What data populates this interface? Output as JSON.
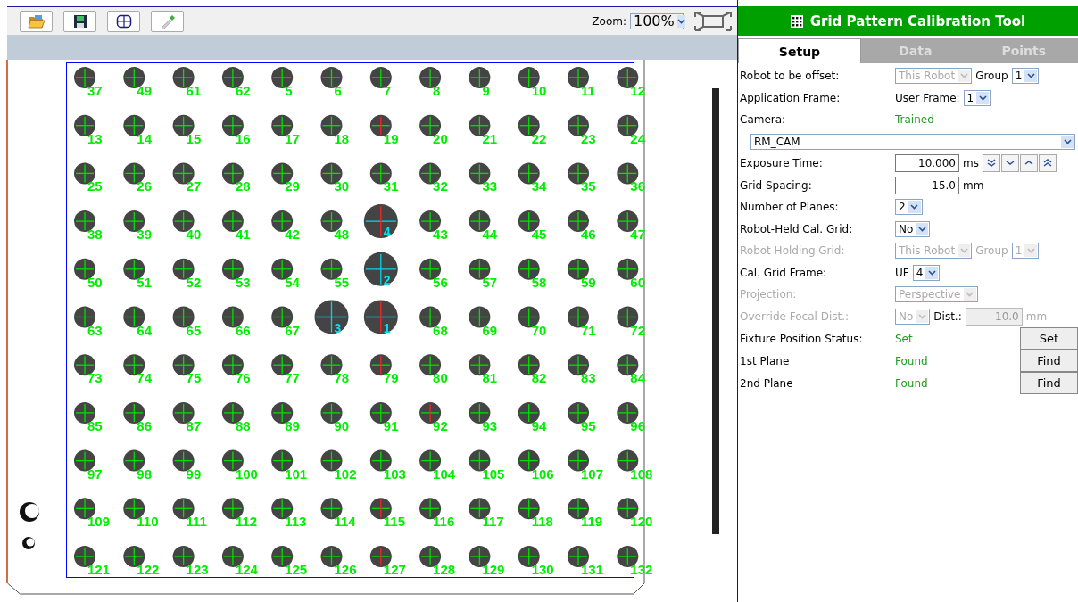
{
  "toolbar": {
    "zoom_label": "Zoom:",
    "zoom_value": "100%"
  },
  "grid": {
    "rows": [
      [
        {
          "label": "37",
          "large": false,
          "flagged": false
        },
        {
          "label": "49",
          "large": false,
          "flagged": false
        },
        {
          "label": "61",
          "large": false,
          "flagged": false
        },
        {
          "label": "62",
          "large": false,
          "flagged": false
        },
        {
          "label": "5",
          "large": false,
          "flagged": false
        },
        {
          "label": "6",
          "large": false,
          "flagged": false
        },
        {
          "label": "7",
          "large": false,
          "flagged": false
        },
        {
          "label": "8",
          "large": false,
          "flagged": false
        },
        {
          "label": "9",
          "large": false,
          "flagged": false
        },
        {
          "label": "10",
          "large": false,
          "flagged": false
        },
        {
          "label": "11",
          "large": false,
          "flagged": false
        },
        {
          "label": "12",
          "large": false,
          "flagged": false
        }
      ],
      [
        {
          "label": "13",
          "large": false,
          "flagged": false
        },
        {
          "label": "14",
          "large": false,
          "flagged": false
        },
        {
          "label": "15",
          "large": false,
          "flagged": false
        },
        {
          "label": "16",
          "large": false,
          "flagged": false
        },
        {
          "label": "17",
          "large": false,
          "flagged": false
        },
        {
          "label": "18",
          "large": false,
          "flagged": false
        },
        {
          "label": "19",
          "large": false,
          "flagged": true
        },
        {
          "label": "20",
          "large": false,
          "flagged": false
        },
        {
          "label": "21",
          "large": false,
          "flagged": false
        },
        {
          "label": "22",
          "large": false,
          "flagged": false
        },
        {
          "label": "23",
          "large": false,
          "flagged": false
        },
        {
          "label": "24",
          "large": false,
          "flagged": false
        }
      ],
      [
        {
          "label": "25",
          "large": false,
          "flagged": false
        },
        {
          "label": "26",
          "large": false,
          "flagged": false
        },
        {
          "label": "27",
          "large": false,
          "flagged": false
        },
        {
          "label": "28",
          "large": false,
          "flagged": false
        },
        {
          "label": "29",
          "large": false,
          "flagged": false
        },
        {
          "label": "30",
          "large": false,
          "flagged": false
        },
        {
          "label": "31",
          "large": false,
          "flagged": false
        },
        {
          "label": "32",
          "large": false,
          "flagged": false
        },
        {
          "label": "33",
          "large": false,
          "flagged": false
        },
        {
          "label": "34",
          "large": false,
          "flagged": false
        },
        {
          "label": "35",
          "large": false,
          "flagged": false
        },
        {
          "label": "36",
          "large": false,
          "flagged": false
        }
      ],
      [
        {
          "label": "38",
          "large": false,
          "flagged": false
        },
        {
          "label": "39",
          "large": false,
          "flagged": false
        },
        {
          "label": "40",
          "large": false,
          "flagged": false
        },
        {
          "label": "41",
          "large": false,
          "flagged": false
        },
        {
          "label": "42",
          "large": false,
          "flagged": false
        },
        {
          "label": "48",
          "large": false,
          "flagged": false
        },
        {
          "label": "4",
          "large": true,
          "flagged": true
        },
        {
          "label": "43",
          "large": false,
          "flagged": false
        },
        {
          "label": "44",
          "large": false,
          "flagged": false
        },
        {
          "label": "45",
          "large": false,
          "flagged": false
        },
        {
          "label": "46",
          "large": false,
          "flagged": false
        },
        {
          "label": "47",
          "large": false,
          "flagged": false
        }
      ],
      [
        {
          "label": "50",
          "large": false,
          "flagged": false
        },
        {
          "label": "51",
          "large": false,
          "flagged": false
        },
        {
          "label": "52",
          "large": false,
          "flagged": false
        },
        {
          "label": "53",
          "large": false,
          "flagged": false
        },
        {
          "label": "54",
          "large": false,
          "flagged": false
        },
        {
          "label": "55",
          "large": false,
          "flagged": false
        },
        {
          "label": "2",
          "large": true,
          "flagged": false
        },
        {
          "label": "56",
          "large": false,
          "flagged": false
        },
        {
          "label": "57",
          "large": false,
          "flagged": false
        },
        {
          "label": "58",
          "large": false,
          "flagged": false
        },
        {
          "label": "59",
          "large": false,
          "flagged": false
        },
        {
          "label": "60",
          "large": false,
          "flagged": false
        }
      ],
      [
        {
          "label": "63",
          "large": false,
          "flagged": false
        },
        {
          "label": "64",
          "large": false,
          "flagged": false
        },
        {
          "label": "65",
          "large": false,
          "flagged": false
        },
        {
          "label": "66",
          "large": false,
          "flagged": false
        },
        {
          "label": "67",
          "large": false,
          "flagged": false
        },
        {
          "label": "3",
          "large": true,
          "flagged": false
        },
        {
          "label": "1",
          "large": true,
          "flagged": true
        },
        {
          "label": "68",
          "large": false,
          "flagged": false
        },
        {
          "label": "69",
          "large": false,
          "flagged": false
        },
        {
          "label": "70",
          "large": false,
          "flagged": false
        },
        {
          "label": "71",
          "large": false,
          "flagged": false
        },
        {
          "label": "72",
          "large": false,
          "flagged": false
        }
      ],
      [
        {
          "label": "73",
          "large": false,
          "flagged": false
        },
        {
          "label": "74",
          "large": false,
          "flagged": false
        },
        {
          "label": "75",
          "large": false,
          "flagged": false
        },
        {
          "label": "76",
          "large": false,
          "flagged": false
        },
        {
          "label": "77",
          "large": false,
          "flagged": false
        },
        {
          "label": "78",
          "large": false,
          "flagged": false
        },
        {
          "label": "79",
          "large": false,
          "flagged": true
        },
        {
          "label": "80",
          "large": false,
          "flagged": false
        },
        {
          "label": "81",
          "large": false,
          "flagged": false
        },
        {
          "label": "82",
          "large": false,
          "flagged": false
        },
        {
          "label": "83",
          "large": false,
          "flagged": false
        },
        {
          "label": "84",
          "large": false,
          "flagged": false
        }
      ],
      [
        {
          "label": "85",
          "large": false,
          "flagged": false
        },
        {
          "label": "86",
          "large": false,
          "flagged": false
        },
        {
          "label": "87",
          "large": false,
          "flagged": false
        },
        {
          "label": "88",
          "large": false,
          "flagged": false
        },
        {
          "label": "89",
          "large": false,
          "flagged": false
        },
        {
          "label": "90",
          "large": false,
          "flagged": false
        },
        {
          "label": "91",
          "large": false,
          "flagged": false
        },
        {
          "label": "92",
          "large": false,
          "flagged": true
        },
        {
          "label": "93",
          "large": false,
          "flagged": false
        },
        {
          "label": "94",
          "large": false,
          "flagged": false
        },
        {
          "label": "95",
          "large": false,
          "flagged": false
        },
        {
          "label": "96",
          "large": false,
          "flagged": false
        }
      ],
      [
        {
          "label": "97",
          "large": false,
          "flagged": false
        },
        {
          "label": "98",
          "large": false,
          "flagged": false
        },
        {
          "label": "99",
          "large": false,
          "flagged": false
        },
        {
          "label": "100",
          "large": false,
          "flagged": false
        },
        {
          "label": "101",
          "large": false,
          "flagged": false
        },
        {
          "label": "102",
          "large": false,
          "flagged": false
        },
        {
          "label": "103",
          "large": false,
          "flagged": false
        },
        {
          "label": "104",
          "large": false,
          "flagged": false
        },
        {
          "label": "105",
          "large": false,
          "flagged": false
        },
        {
          "label": "106",
          "large": false,
          "flagged": false
        },
        {
          "label": "107",
          "large": false,
          "flagged": false
        },
        {
          "label": "108",
          "large": false,
          "flagged": false
        }
      ],
      [
        {
          "label": "109",
          "large": false,
          "flagged": false
        },
        {
          "label": "110",
          "large": false,
          "flagged": false
        },
        {
          "label": "111",
          "large": false,
          "flagged": false
        },
        {
          "label": "112",
          "large": false,
          "flagged": false
        },
        {
          "label": "113",
          "large": false,
          "flagged": false
        },
        {
          "label": "114",
          "large": false,
          "flagged": false
        },
        {
          "label": "115",
          "large": false,
          "flagged": true
        },
        {
          "label": "116",
          "large": false,
          "flagged": false
        },
        {
          "label": "117",
          "large": false,
          "flagged": false
        },
        {
          "label": "118",
          "large": false,
          "flagged": false
        },
        {
          "label": "119",
          "large": false,
          "flagged": false
        },
        {
          "label": "120",
          "large": false,
          "flagged": false
        }
      ],
      [
        {
          "label": "121",
          "large": false,
          "flagged": false
        },
        {
          "label": "122",
          "large": false,
          "flagged": false
        },
        {
          "label": "123",
          "large": false,
          "flagged": false
        },
        {
          "label": "124",
          "large": false,
          "flagged": false
        },
        {
          "label": "125",
          "large": false,
          "flagged": false
        },
        {
          "label": "126",
          "large": false,
          "flagged": false
        },
        {
          "label": "127",
          "large": false,
          "flagged": true
        },
        {
          "label": "128",
          "large": false,
          "flagged": false
        },
        {
          "label": "129",
          "large": false,
          "flagged": false
        },
        {
          "label": "130",
          "large": false,
          "flagged": false
        },
        {
          "label": "131",
          "large": false,
          "flagged": false
        },
        {
          "label": "132",
          "large": false,
          "flagged": false
        }
      ]
    ]
  },
  "panel": {
    "title": "Grid Pattern Calibration Tool",
    "tabs": [
      {
        "label": "Setup",
        "selected": true
      },
      {
        "label": "Data",
        "selected": false
      },
      {
        "label": "Points",
        "selected": false
      }
    ],
    "rows": [
      {
        "label": "Robot to be offset:",
        "disabled": false,
        "controls": [
          {
            "kind": "select",
            "value": "This Robot",
            "disabled": true
          },
          {
            "kind": "text",
            "value": "Group",
            "disabled": false
          },
          {
            "kind": "select",
            "value": "1",
            "disabled": false
          }
        ]
      },
      {
        "label": "Application Frame:",
        "disabled": false,
        "controls": [
          {
            "kind": "text",
            "value": "User Frame:",
            "disabled": false
          },
          {
            "kind": "select",
            "value": "1",
            "disabled": false
          }
        ]
      },
      {
        "label": "Camera:",
        "disabled": false,
        "controls": [
          {
            "kind": "status",
            "value": "Trained"
          }
        ]
      },
      {
        "controls": [
          {
            "kind": "wide-select",
            "value": "RM_CAM",
            "disabled": false
          }
        ]
      },
      {
        "label": "Exposure Time:",
        "disabled": false,
        "controls": [
          {
            "kind": "input",
            "value": "10.000",
            "disabled": false
          },
          {
            "kind": "text",
            "value": "ms",
            "disabled": false
          },
          {
            "kind": "stepper"
          }
        ]
      },
      {
        "label": "Grid Spacing:",
        "disabled": false,
        "controls": [
          {
            "kind": "input",
            "value": "15.0",
            "disabled": false
          },
          {
            "kind": "text",
            "value": "mm",
            "disabled": false
          }
        ]
      },
      {
        "label": "Number of Planes:",
        "disabled": false,
        "controls": [
          {
            "kind": "select",
            "value": "2",
            "disabled": false
          }
        ]
      },
      {
        "label": "Robot-Held Cal. Grid:",
        "disabled": false,
        "controls": [
          {
            "kind": "select",
            "value": "No",
            "disabled": false
          }
        ]
      },
      {
        "label": "Robot Holding Grid:",
        "disabled": true,
        "controls": [
          {
            "kind": "select",
            "value": "This Robot",
            "disabled": true
          },
          {
            "kind": "text",
            "value": "Group",
            "disabled": true
          },
          {
            "kind": "select",
            "value": "1",
            "disabled": true
          }
        ]
      },
      {
        "label": "Cal. Grid Frame:",
        "disabled": false,
        "controls": [
          {
            "kind": "text",
            "value": "UF",
            "disabled": false
          },
          {
            "kind": "select",
            "value": "4",
            "disabled": false
          }
        ]
      },
      {
        "label": "Projection:",
        "disabled": true,
        "controls": [
          {
            "kind": "select",
            "value": "Perspective",
            "disabled": true
          }
        ]
      },
      {
        "label": "Override Focal Dist.:",
        "disabled": true,
        "controls": [
          {
            "kind": "select",
            "value": "No",
            "disabled": true
          },
          {
            "kind": "text",
            "value": "Dist.:",
            "disabled": false
          },
          {
            "kind": "input",
            "value": "10.0",
            "disabled": true
          },
          {
            "kind": "text",
            "value": "mm",
            "disabled": true
          }
        ]
      },
      {
        "label": "Fixture Position Status:",
        "disabled": false,
        "controls": [
          {
            "kind": "status",
            "value": "Set"
          },
          {
            "kind": "button",
            "value": "Set"
          }
        ]
      },
      {
        "label": "1st Plane",
        "disabled": false,
        "controls": [
          {
            "kind": "status",
            "value": "Found"
          },
          {
            "kind": "button",
            "value": "Find"
          }
        ]
      },
      {
        "label": "2nd Plane",
        "disabled": false,
        "controls": [
          {
            "kind": "status",
            "value": "Found"
          },
          {
            "kind": "button",
            "value": "Find"
          }
        ]
      }
    ]
  }
}
